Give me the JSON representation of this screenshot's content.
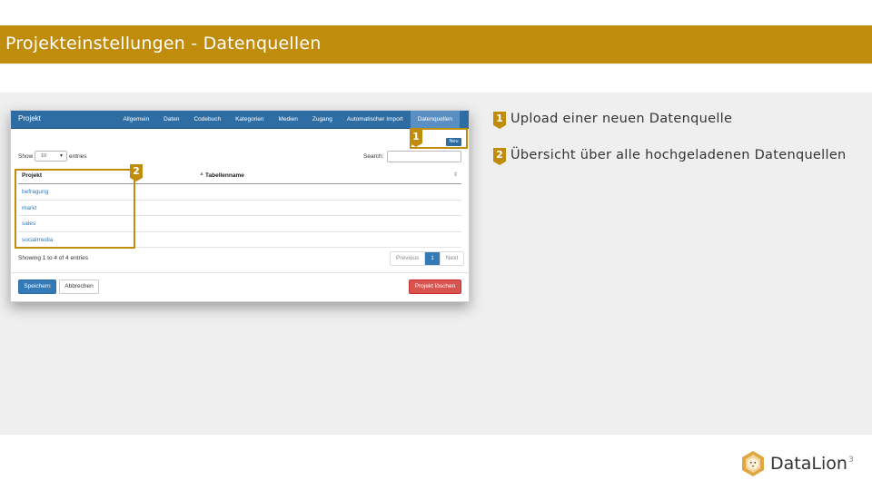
{
  "slide": {
    "title": "Projekteinstellungen - Datenquellen",
    "page_number": "3"
  },
  "screenshot": {
    "brand": "Projekt",
    "tabs": [
      {
        "label": "Allgemein",
        "active": false
      },
      {
        "label": "Daten",
        "active": false
      },
      {
        "label": "Codebuch",
        "active": false
      },
      {
        "label": "Kategorien",
        "active": false
      },
      {
        "label": "Medien",
        "active": false
      },
      {
        "label": "Zugang",
        "active": false
      },
      {
        "label": "Automatischer Import",
        "active": false
      },
      {
        "label": "Datenquellen",
        "active": true
      }
    ],
    "new_button": "Neu",
    "show_label": "Show",
    "show_value": "10",
    "entries_label": "entries",
    "search_label": "Search:",
    "columns": [
      "Projekt",
      "Tabellenname"
    ],
    "rows": [
      "befragung",
      "markt",
      "sales",
      "socialmedia"
    ],
    "info": "Showing 1 to 4 of 4 entries",
    "pagination": {
      "previous": "Previous",
      "current": "1",
      "next": "Next"
    },
    "buttons": {
      "save": "Speichern",
      "cancel": "Abbrechen",
      "delete": "Projekt löschen"
    }
  },
  "annotations": [
    {
      "number": "1",
      "text": "Upload einer neuen Datenquelle"
    },
    {
      "number": "2",
      "text": "Übersicht über alle hochgeladenen Datenquellen"
    }
  ],
  "logo": {
    "text": "DataLion",
    "icon": "lion-icon"
  },
  "colors": {
    "accent": "#bf8c0c",
    "nav": "#2e6da4",
    "link": "#337ab7",
    "danger": "#d9534f"
  }
}
